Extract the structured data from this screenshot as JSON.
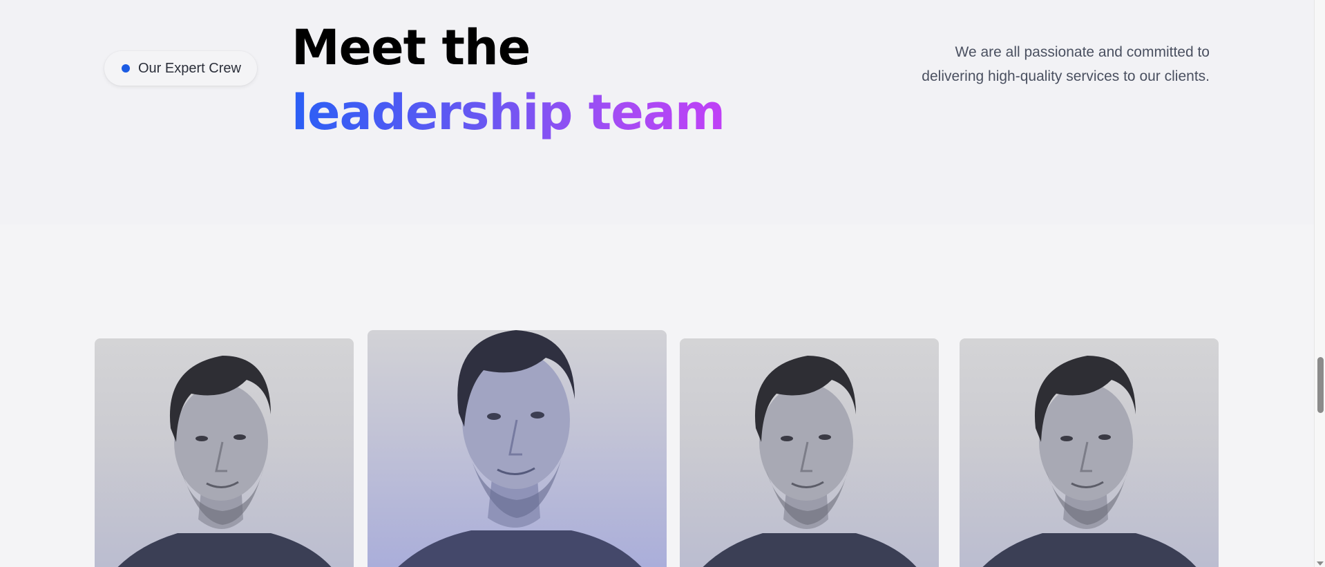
{
  "badge": {
    "label": "Our Expert Crew",
    "dot_color": "#1b5be3"
  },
  "headline": {
    "line1": "Meet the",
    "line2": "leadership team"
  },
  "intro": {
    "text": "We are all passionate and committed to delivering high-quality services to our clients."
  },
  "team": {
    "cards": [
      {
        "icon": "portrait-photo"
      },
      {
        "icon": "portrait-photo",
        "featured": true
      },
      {
        "icon": "portrait-photo"
      },
      {
        "icon": "portrait-photo"
      }
    ]
  },
  "colors": {
    "gradient_start": "#2a5ff5",
    "gradient_end": "#c040f6",
    "accent_blue": "#1b5be3"
  }
}
